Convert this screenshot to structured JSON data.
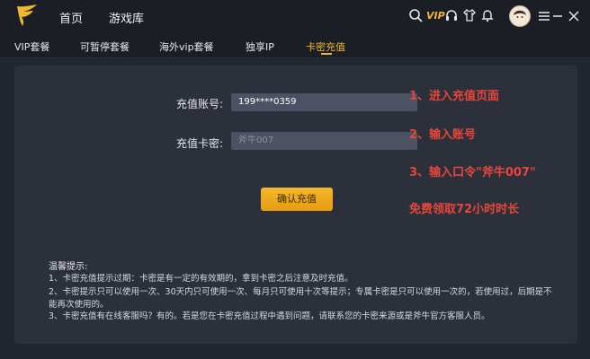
{
  "header": {
    "nav": [
      "首页",
      "游戏库"
    ],
    "vip_label": "VIP"
  },
  "subtabs": [
    "VIP套餐",
    "可暂停套餐",
    "海外vip套餐",
    "独享IP",
    "卡密充值"
  ],
  "form": {
    "account_label": "充值账号:",
    "account_value": "199****0359",
    "card_label": "充值卡密:",
    "card_placeholder": "斧牛007",
    "confirm_label": "确认充值"
  },
  "annotations": [
    "1、进入充值页面",
    "2、输入账号",
    "3、输入口令\"斧牛007\"",
    "免费领取72小时时长"
  ],
  "tips": {
    "title": "温馨提示:",
    "items": [
      "1、卡密充值提示过期：卡密是有一定的有效期的，拿到卡密之后注意及时充值。",
      "2、卡密提示只可以使用一次、30天内只可使用一次、每月只可使用十次等提示；专属卡密是只可以使用一次的，若使用过，后期是不能再次使用的。",
      "3、卡密充值有在线客服吗？有的。若是您在卡密充值过程中遇到问题，请联系您的卡密来源或是斧牛官方客服人员。"
    ]
  },
  "colors": {
    "accent": "#f0b92a",
    "annotation": "#e8463b",
    "panel": "#2b303b"
  }
}
